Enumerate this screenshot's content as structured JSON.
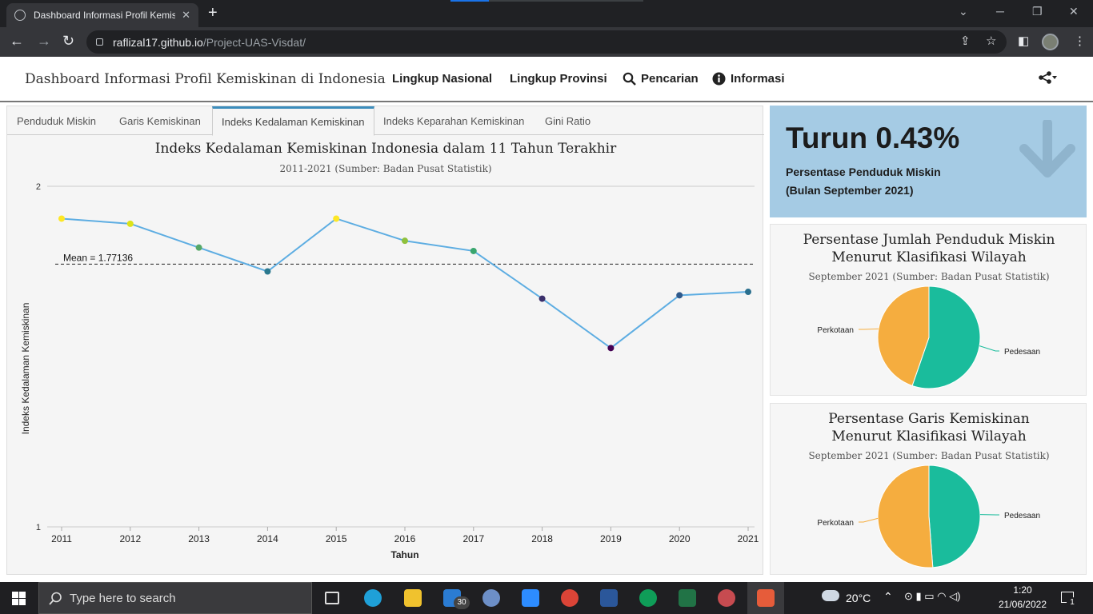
{
  "browser": {
    "tab_title": "Dashboard Informasi Profil Kemis",
    "url_domain": "raflizal17.github.io",
    "url_path": "/Project-UAS-Visdat/"
  },
  "app": {
    "brand": "Dashboard Informasi Profil Kemiskinan di Indonesia",
    "nav": [
      "Lingkup Nasional",
      "Lingkup Provinsi",
      "Pencarian",
      "Informasi"
    ]
  },
  "panel_tabs": [
    "Penduduk Miskin",
    "Garis Kemiskinan",
    "Indeks Kedalaman Kemiskinan",
    "Indeks Keparahan Kemiskinan",
    "Gini Ratio"
  ],
  "chart_data": [
    {
      "type": "line",
      "title": "Indeks Kedalaman Kemiskinan Indonesia dalam 11 Tahun Terakhir",
      "subtitle": "2011-2021 (Sumber: Badan Pusat Statistik)",
      "xlabel": "Tahun",
      "ylabel": "Indeks Kedalaman Kemiskinan",
      "x": [
        "2011",
        "2012",
        "2013",
        "2014",
        "2015",
        "2016",
        "2017",
        "2018",
        "2019",
        "2020",
        "2021"
      ],
      "y": [
        1.905,
        1.89,
        1.82,
        1.75,
        1.905,
        1.84,
        1.81,
        1.67,
        1.525,
        1.68,
        1.69
      ],
      "ylim": [
        1,
        2
      ],
      "yticks": [
        "1",
        "2"
      ],
      "mean_label": "Mean = 1.77136",
      "mean_value": 1.77136,
      "point_colors": [
        "#fde725",
        "#dce319",
        "#55a868",
        "#2a788e",
        "#fde725",
        "#8fc13d",
        "#3aa66e",
        "#3b2f6b",
        "#440154",
        "#2f5a8c",
        "#2a6f8e"
      ],
      "line_color": "#5dade2"
    },
    {
      "type": "pie",
      "title_lines": [
        "Persentase Jumlah Penduduk Miskin",
        "Menurut Klasifikasi Wilayah"
      ],
      "subtitle": "September 2021 (Sumber: Badan Pusat Statistik)",
      "labels": [
        "Pedesaan",
        "Perkotaan"
      ],
      "values": [
        55.3,
        44.7
      ],
      "colors": [
        "#1abc9c",
        "#f5ad3f"
      ]
    },
    {
      "type": "pie",
      "title_lines": [
        "Persentase Garis Kemiskinan",
        "Menurut Klasifikasi Wilayah"
      ],
      "subtitle": "September 2021 (Sumber: Badan Pusat Statistik)",
      "labels": [
        "Pedesaan",
        "Perkotaan"
      ],
      "values": [
        48.8,
        51.2
      ],
      "colors": [
        "#1abc9c",
        "#f5ad3f"
      ]
    }
  ],
  "infobox": {
    "headline": "Turun 0.43%",
    "line1": "Persentase Penduduk Miskin",
    "line2": "(Bulan September 2021)"
  },
  "taskbar": {
    "search_placeholder": "Type here to search",
    "weather": "20°C",
    "time": "1:20",
    "date": "21/06/2022",
    "mail_badge": "30",
    "notif_badge": "1"
  }
}
